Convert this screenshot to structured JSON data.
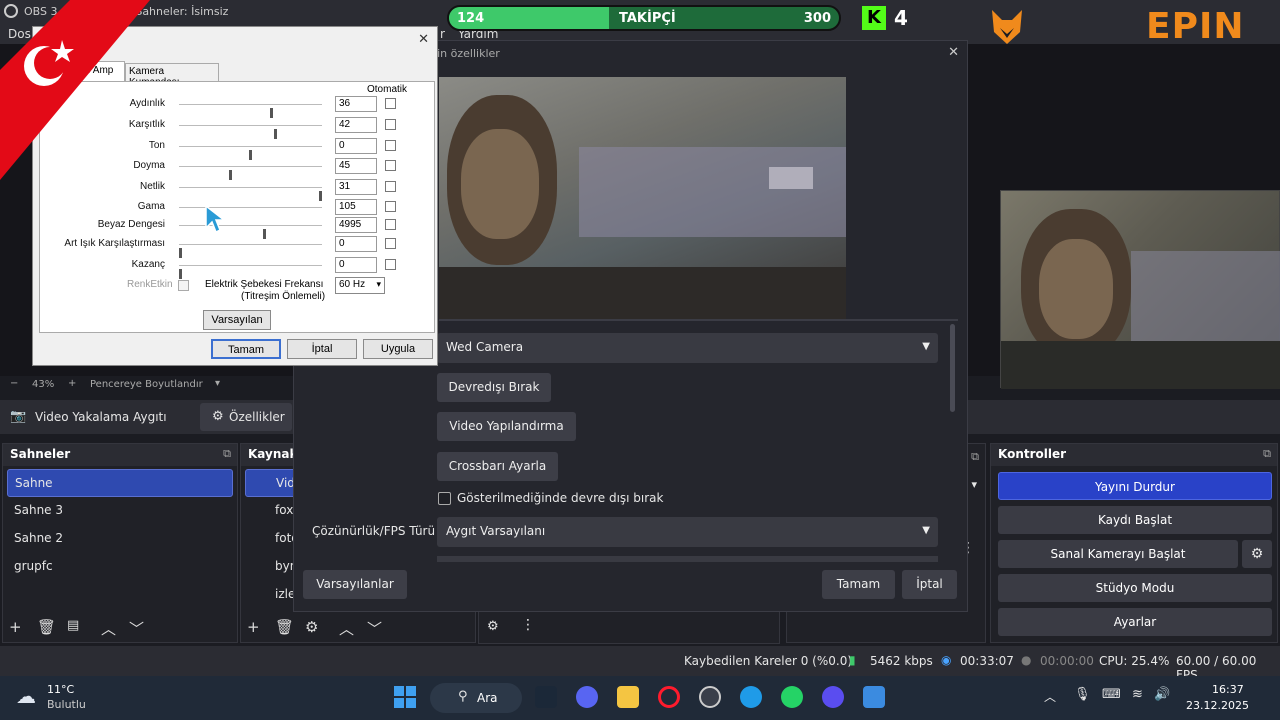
{
  "obs": {
    "title": "OBS 3",
    "title_rest": "k - Sahneler: İsimsiz",
    "menu_left": "Dos",
    "menu_right": "r",
    "menu_help": "Yardım"
  },
  "overlay": {
    "followers_current": "124",
    "followers_label": "TAKİPÇİ",
    "followers_goal": "300",
    "progress_fraction": 0.41,
    "kick_letter": "K",
    "kick_count": "4",
    "brand": "EPIN",
    "colors": {
      "progress": "#3ec96a",
      "kick": "#53fc18",
      "brand": "#f08a1c",
      "flag": "#e30a17"
    }
  },
  "zoom": {
    "minus": "−",
    "value": "43%",
    "plus": "+",
    "fit_label": "Pencereye Boyutlandır"
  },
  "source_toolbar": {
    "source_name": "Video Yakalama Aygıtı",
    "props_button": "Özellikler"
  },
  "scenes": {
    "title": "Sahneler",
    "items": [
      "Sahne",
      "Sahne 3",
      "Sahne 2",
      "grupfc"
    ]
  },
  "sources": {
    "title": "Kaynak",
    "items": [
      "Vide",
      "foxb",
      "foto",
      "byn",
      "izley"
    ]
  },
  "controls": {
    "title": "Kontroller",
    "stop_stream": "Yayını Durdur",
    "start_record": "Kaydı Başlat",
    "virtual_cam": "Sanal Kamerayı Başlat",
    "studio": "Stüdyo Modu",
    "settings": "Ayarlar"
  },
  "properties": {
    "title": "için özellikler",
    "device": "Wed Camera",
    "deactivate": "Devredışı Bırak",
    "video_config": "Video Yapılandırma",
    "crossbar": "Crossbarı Ayarla",
    "hide_checkbox": "Gösterilmediğinde devre dışı bırak",
    "fps_label": "Çözünürlük/FPS Türü",
    "fps_value": "Aygıt Varsayılanı",
    "defaults": "Varsayılanlar",
    "ok": "Tamam",
    "cancel": "İptal"
  },
  "procamp": {
    "tab1": "oc Amp",
    "tab2": "Kamera Kumandası",
    "auto_header": "Otomatik",
    "rows": [
      {
        "label": "Aydınlık",
        "value": "36",
        "pos": 0.65
      },
      {
        "label": "Karşıtlık",
        "value": "42",
        "pos": 0.68
      },
      {
        "label": "Ton",
        "value": "0",
        "pos": 0.5
      },
      {
        "label": "Doyma",
        "value": "45",
        "pos": 0.36
      },
      {
        "label": "Netlik",
        "value": "31",
        "pos": 1.0
      },
      {
        "label": "Gama",
        "value": "105",
        "pos": 0.22
      },
      {
        "label": "Beyaz Dengesi",
        "value": "4995",
        "pos": 0.6
      },
      {
        "label": "Art Işık Karşılaştırması",
        "value": "0",
        "pos": 0.0
      },
      {
        "label": "Kazanç",
        "value": "0",
        "pos": 0.0
      }
    ],
    "color_enable": "RenkEtkin",
    "freq_label_1": "Elektrik Şebekesi Frekansı",
    "freq_label_2": "(Titreşim Önlemeli)",
    "freq_value": "60 Hz",
    "defaults": "Varsayılan",
    "ok": "Tamam",
    "cancel": "İptal",
    "apply": "Uygula",
    "close": "✕"
  },
  "status": {
    "dropped": "Kaybedilen Kareler 0 (%0.0)",
    "bitrate": "5462 kbps",
    "stream_time": "00:33:07",
    "rec_time": "00:00:00",
    "cpu": "CPU: 25.4%",
    "fps": "60.00 / 60.00 FPS"
  },
  "taskbar": {
    "temp": "11°C",
    "weather": "Bulutlu",
    "search": "Ara",
    "time": "16:37",
    "date": "23.12.2025"
  }
}
